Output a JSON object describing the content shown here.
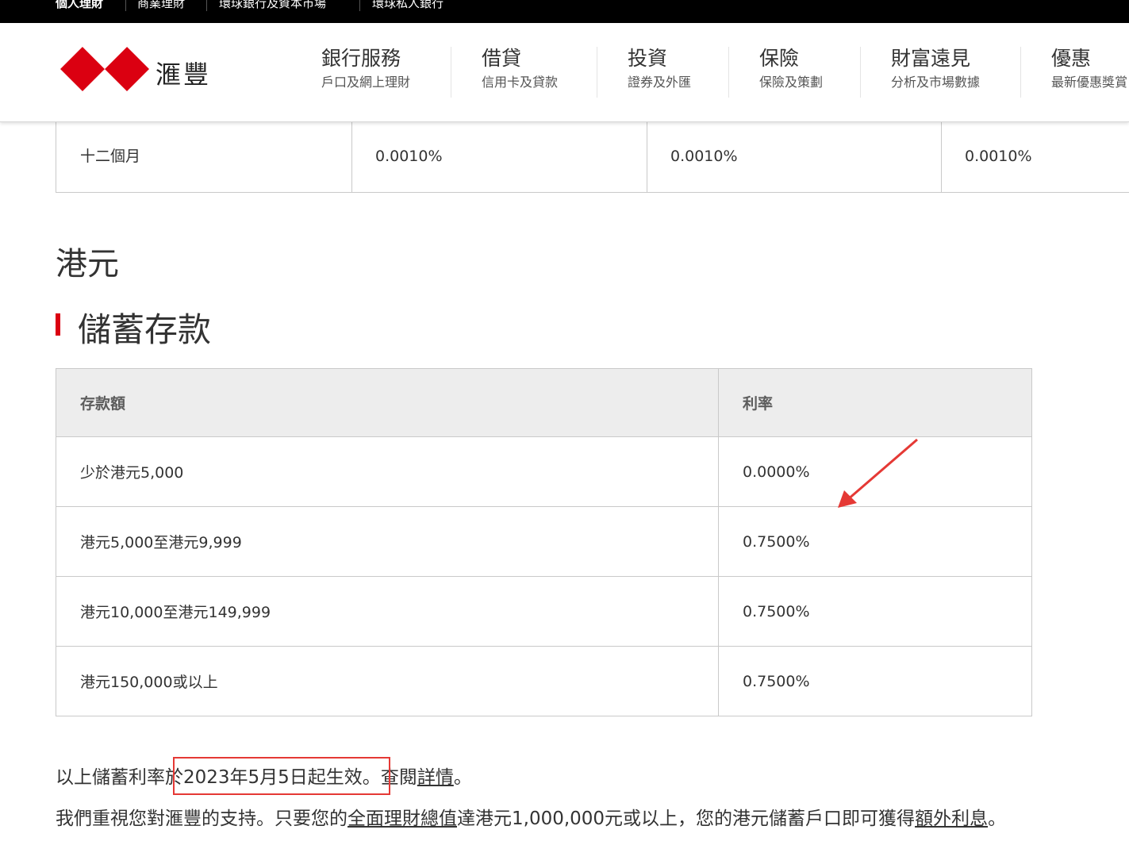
{
  "topbar": {
    "items": [
      "個人理財",
      "商業理財",
      "環球銀行及資本市場",
      "環球私人銀行"
    ]
  },
  "header": {
    "brand_name": "滙豐",
    "nav": [
      {
        "title": "銀行服務",
        "subtitle": "戶口及網上理財"
      },
      {
        "title": "借貸",
        "subtitle": "信用卡及貸款"
      },
      {
        "title": "投資",
        "subtitle": "證券及外匯"
      },
      {
        "title": "保險",
        "subtitle": "保險及策劃"
      },
      {
        "title": "財富遠見",
        "subtitle": "分析及市場數據"
      },
      {
        "title": "優惠",
        "subtitle": "最新優惠獎賞"
      }
    ]
  },
  "previous_table": {
    "row": [
      "十二個月",
      "0.0010%",
      "0.0010%",
      "0.0010%"
    ]
  },
  "currency_heading": "港元",
  "section_heading": "儲蓄存款",
  "rates_table": {
    "headers": [
      "存款額",
      "利率"
    ],
    "rows": [
      [
        "少於港元5,000",
        "0.0000%"
      ],
      [
        "港元5,000至港元9,999",
        "0.7500%"
      ],
      [
        "港元10,000至港元149,999",
        "0.7500%"
      ],
      [
        "港元150,000或以上",
        "0.7500%"
      ]
    ]
  },
  "notes": {
    "p1_prefix": "以上儲蓄利率於",
    "p1_date": "2023年5月5日起生效。",
    "p1_view": "查閱",
    "p1_link": "詳情",
    "p1_end": "。",
    "p2_a": "我們重視您對滙豐的支持。只要您的",
    "p2_link1": "全面理財總值",
    "p2_b": "達港元1,000,000元或以上，您的港元儲蓄戶口即可獲得",
    "p2_link2": "額外利息",
    "p2_end": "。"
  },
  "colors": {
    "brand_red": "#db0011",
    "annotation_red": "#e53935",
    "header_bg": "#ededed"
  }
}
